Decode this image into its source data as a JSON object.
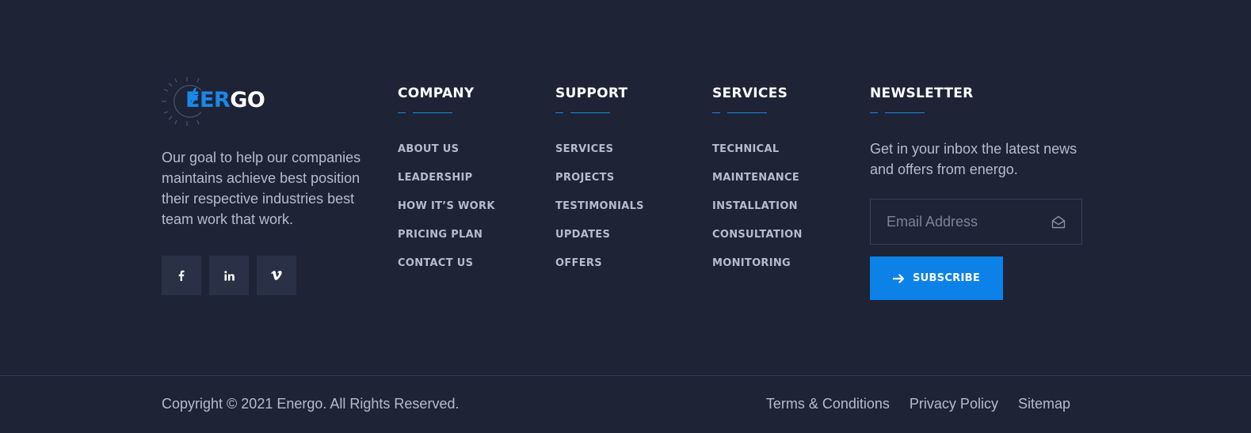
{
  "brand": {
    "logo_part1": "E",
    "logo_part2": "ER",
    "logo_part3": "GO",
    "accent_color": "#1a88e8",
    "background_color": "#1e2336"
  },
  "about": {
    "text": "Our goal to help our companies maintains achieve best position their respective industries best team work that work."
  },
  "socials": [
    {
      "icon": "facebook-icon",
      "glyph": "f"
    },
    {
      "icon": "linkedin-icon",
      "glyph": "in"
    },
    {
      "icon": "vimeo-icon",
      "glyph": "v"
    }
  ],
  "company": {
    "title": "COMPANY",
    "links": [
      "ABOUT US",
      "LEADERSHIP",
      "HOW IT’S WORK",
      "PRICING PLAN",
      "CONTACT US"
    ]
  },
  "support": {
    "title": "SUPPORT",
    "links": [
      "SERVICES",
      "PROJECTS",
      "TESTIMONIALS",
      "UPDATES",
      "OFFERS"
    ]
  },
  "services": {
    "title": "SERVICES",
    "links": [
      "TECHNICAL",
      "MAINTENANCE",
      "INSTALLATION",
      "CONSULTATION",
      "MONITORING"
    ]
  },
  "newsletter": {
    "title": "NEWSLETTER",
    "text": "Get in your inbox the latest news and offers from energo.",
    "email_placeholder": "Email Address",
    "subscribe_label": "SUBSCRIBE"
  },
  "bottom": {
    "copyright": "Copyright © 2021 Energo. All Rights Reserved.",
    "links": [
      "Terms & Conditions",
      "Privacy Policy",
      "Sitemap"
    ]
  }
}
